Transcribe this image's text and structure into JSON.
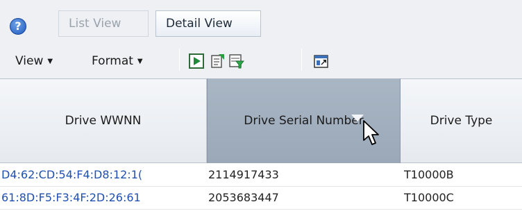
{
  "toolbar": {
    "tabs": [
      "List View",
      "Detail View"
    ],
    "menus": [
      "View",
      "Format"
    ],
    "icons": [
      "help-icon",
      "play-icon",
      "export-icon",
      "filter-icon",
      "detach-icon"
    ]
  },
  "table": {
    "columns": [
      "Drive WWNN",
      "Drive Serial Number",
      "Drive Type"
    ],
    "sorted_column": "Drive Serial Number",
    "rows": [
      [
        "D4:62:CD:54:F4:D8:12:1(",
        "2114917433",
        "T10000B"
      ],
      [
        "61:8D:F5:F3:4F:2D:26:61",
        "2053683447",
        "T10000C"
      ]
    ]
  },
  "colors": {
    "header_selected": "#9aa8b8",
    "link": "#1f4fb0",
    "toolbar_bg": "#eef0f4"
  }
}
